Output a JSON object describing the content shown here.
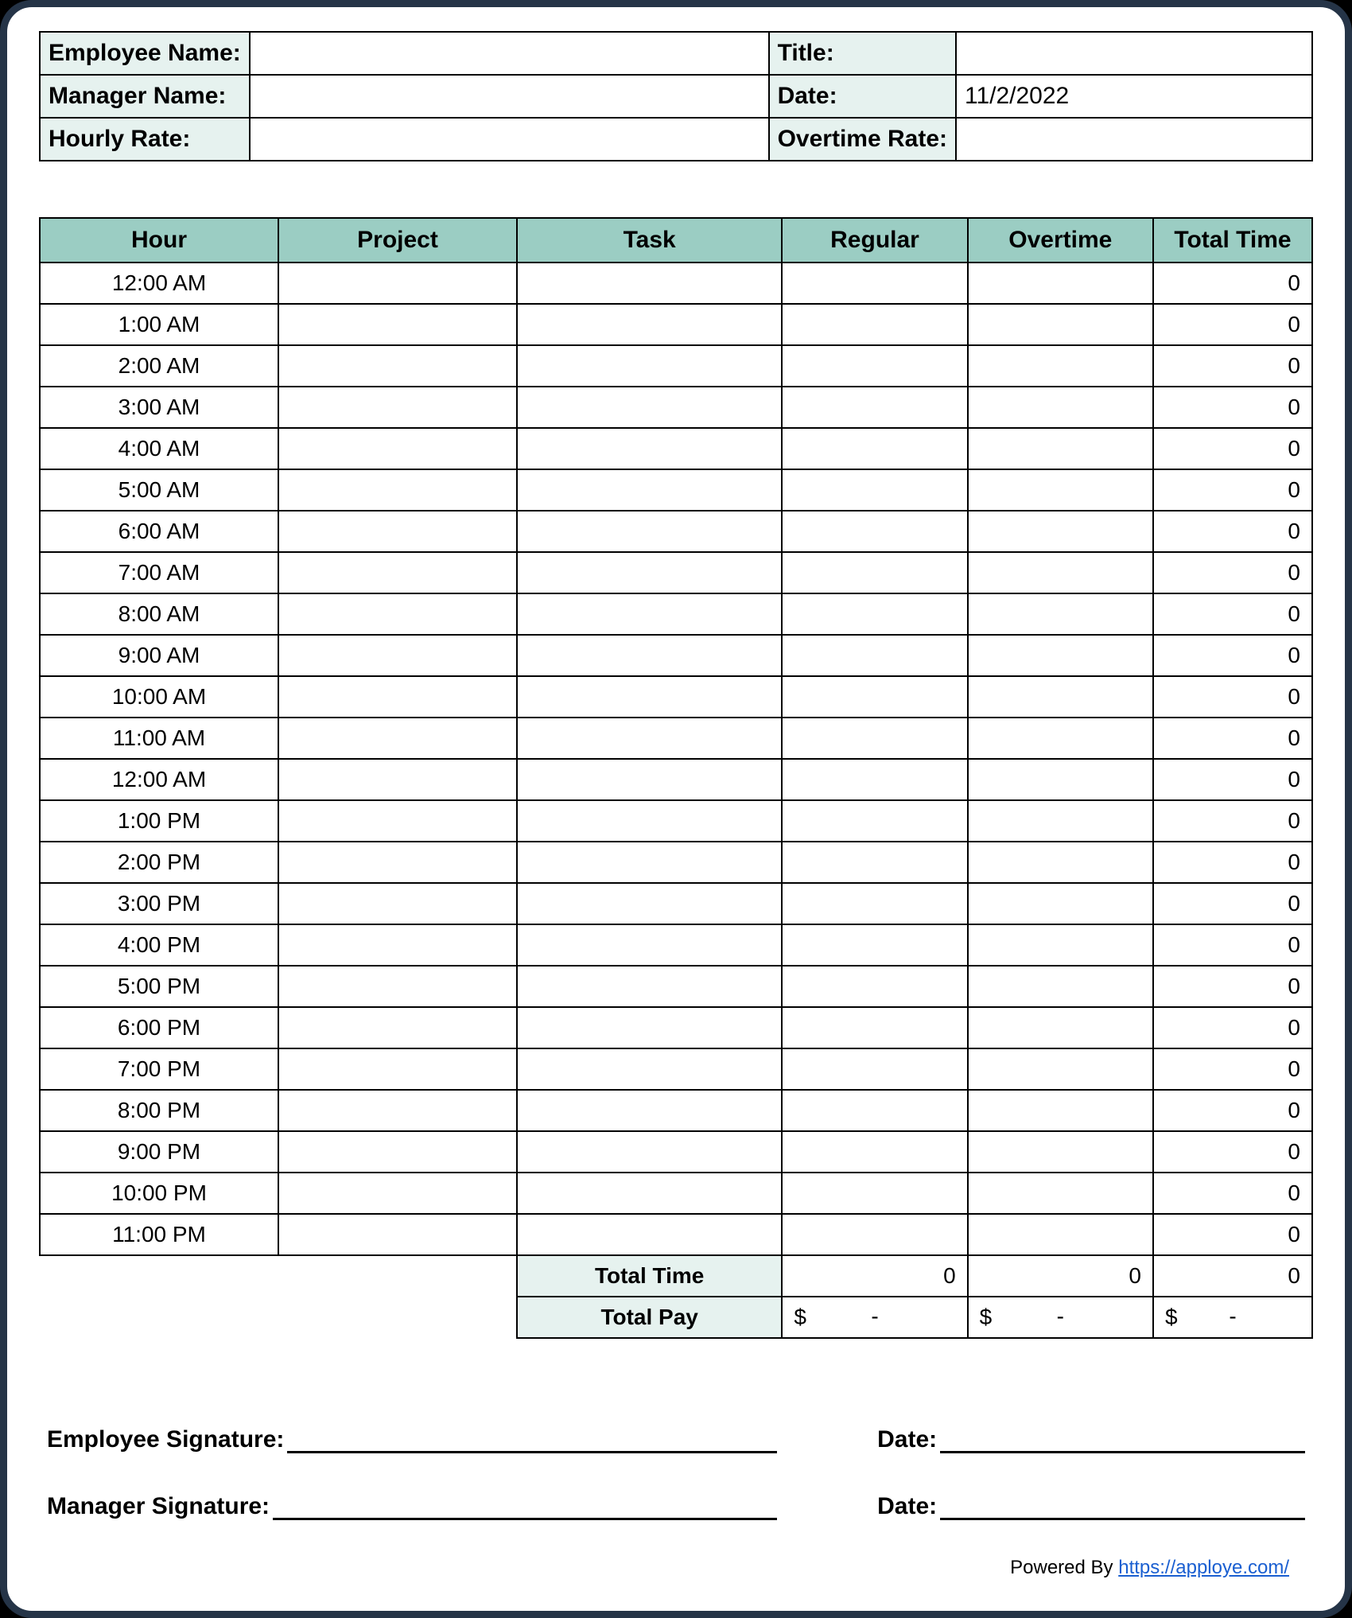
{
  "info": {
    "employee_name_label": "Employee Name:",
    "employee_name_value": "",
    "title_label": "Title:",
    "title_value": "",
    "manager_name_label": "Manager Name:",
    "manager_name_value": "",
    "date_label": "Date:",
    "date_value": "11/2/2022",
    "hourly_rate_label": "Hourly Rate:",
    "hourly_rate_value": "",
    "overtime_rate_label": "Overtime Rate:",
    "overtime_rate_value": ""
  },
  "headers": {
    "hour": "Hour",
    "project": "Project",
    "task": "Task",
    "regular": "Regular",
    "overtime": "Overtime",
    "total_time": "Total Time"
  },
  "rows": [
    {
      "hour": "12:00 AM",
      "project": "",
      "task": "",
      "regular": "",
      "overtime": "",
      "total": "0"
    },
    {
      "hour": "1:00 AM",
      "project": "",
      "task": "",
      "regular": "",
      "overtime": "",
      "total": "0"
    },
    {
      "hour": "2:00 AM",
      "project": "",
      "task": "",
      "regular": "",
      "overtime": "",
      "total": "0"
    },
    {
      "hour": "3:00 AM",
      "project": "",
      "task": "",
      "regular": "",
      "overtime": "",
      "total": "0"
    },
    {
      "hour": "4:00 AM",
      "project": "",
      "task": "",
      "regular": "",
      "overtime": "",
      "total": "0"
    },
    {
      "hour": "5:00 AM",
      "project": "",
      "task": "",
      "regular": "",
      "overtime": "",
      "total": "0"
    },
    {
      "hour": "6:00 AM",
      "project": "",
      "task": "",
      "regular": "",
      "overtime": "",
      "total": "0"
    },
    {
      "hour": "7:00 AM",
      "project": "",
      "task": "",
      "regular": "",
      "overtime": "",
      "total": "0"
    },
    {
      "hour": "8:00 AM",
      "project": "",
      "task": "",
      "regular": "",
      "overtime": "",
      "total": "0"
    },
    {
      "hour": "9:00 AM",
      "project": "",
      "task": "",
      "regular": "",
      "overtime": "",
      "total": "0"
    },
    {
      "hour": "10:00 AM",
      "project": "",
      "task": "",
      "regular": "",
      "overtime": "",
      "total": "0"
    },
    {
      "hour": "11:00 AM",
      "project": "",
      "task": "",
      "regular": "",
      "overtime": "",
      "total": "0"
    },
    {
      "hour": "12:00 AM",
      "project": "",
      "task": "",
      "regular": "",
      "overtime": "",
      "total": "0"
    },
    {
      "hour": "1:00 PM",
      "project": "",
      "task": "",
      "regular": "",
      "overtime": "",
      "total": "0"
    },
    {
      "hour": "2:00 PM",
      "project": "",
      "task": "",
      "regular": "",
      "overtime": "",
      "total": "0"
    },
    {
      "hour": "3:00 PM",
      "project": "",
      "task": "",
      "regular": "",
      "overtime": "",
      "total": "0"
    },
    {
      "hour": "4:00 PM",
      "project": "",
      "task": "",
      "regular": "",
      "overtime": "",
      "total": "0"
    },
    {
      "hour": "5:00 PM",
      "project": "",
      "task": "",
      "regular": "",
      "overtime": "",
      "total": "0"
    },
    {
      "hour": "6:00 PM",
      "project": "",
      "task": "",
      "regular": "",
      "overtime": "",
      "total": "0"
    },
    {
      "hour": "7:00 PM",
      "project": "",
      "task": "",
      "regular": "",
      "overtime": "",
      "total": "0"
    },
    {
      "hour": "8:00 PM",
      "project": "",
      "task": "",
      "regular": "",
      "overtime": "",
      "total": "0"
    },
    {
      "hour": "9:00 PM",
      "project": "",
      "task": "",
      "regular": "",
      "overtime": "",
      "total": "0"
    },
    {
      "hour": "10:00 PM",
      "project": "",
      "task": "",
      "regular": "",
      "overtime": "",
      "total": "0"
    },
    {
      "hour": "11:00 PM",
      "project": "",
      "task": "",
      "regular": "",
      "overtime": "",
      "total": "0"
    }
  ],
  "summary": {
    "total_time_label": "Total Time",
    "total_pay_label": "Total Pay",
    "regular_total_time": "0",
    "overtime_total_time": "0",
    "grand_total_time": "0",
    "dollar": "$",
    "dash": "-"
  },
  "signatures": {
    "employee_sig_label": "Employee Signature:",
    "manager_sig_label": "Manager Signature:",
    "date_label": "Date:"
  },
  "footer": {
    "powered_by": "Powered By ",
    "link_text": "https://apploye.com/"
  }
}
